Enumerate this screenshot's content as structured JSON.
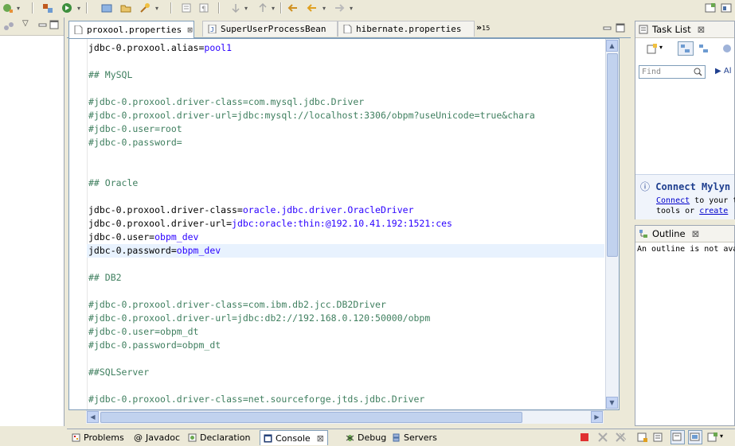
{
  "editor": {
    "tabs": [
      {
        "label": "proxool.properties",
        "active": true
      },
      {
        "label": "SuperUserProcessBean",
        "active": false
      },
      {
        "label": "hibernate.properties",
        "active": false
      }
    ],
    "overflow_count": "15",
    "lines": [
      {
        "type": "kv",
        "key": "jdbc-0.proxool.alias=",
        "value": "pool1"
      },
      {
        "type": "blank"
      },
      {
        "type": "comment",
        "text": "## MySQL"
      },
      {
        "type": "blank"
      },
      {
        "type": "comment",
        "text": "#jdbc-0.proxool.driver-class=com.mysql.jdbc.Driver"
      },
      {
        "type": "comment",
        "text": "#jdbc-0.proxool.driver-url=jdbc:mysql://localhost:3306/obpm?useUnicode=true&chara"
      },
      {
        "type": "comment",
        "text": "#jdbc-0.user=root"
      },
      {
        "type": "comment",
        "text": "#jdbc-0.password="
      },
      {
        "type": "blank"
      },
      {
        "type": "blank"
      },
      {
        "type": "comment",
        "text": "## Oracle"
      },
      {
        "type": "blank"
      },
      {
        "type": "kv",
        "key": "jdbc-0.proxool.driver-class=",
        "value": "oracle.jdbc.driver.OracleDriver"
      },
      {
        "type": "kv",
        "key": "jdbc-0.proxool.driver-url=",
        "value": "jdbc:oracle:thin:@192.10.41.192:1521:ces"
      },
      {
        "type": "kv",
        "key": "jdbc-0.user=",
        "value": "obpm_dev"
      },
      {
        "type": "kv",
        "key": "jdbc-0.password=",
        "value": "obpm_dev",
        "highlight": true
      },
      {
        "type": "blank"
      },
      {
        "type": "comment",
        "text": "## DB2"
      },
      {
        "type": "blank"
      },
      {
        "type": "comment",
        "text": "#jdbc-0.proxool.driver-class=com.ibm.db2.jcc.DB2Driver"
      },
      {
        "type": "comment",
        "text": "#jdbc-0.proxool.driver-url=jdbc:db2://192.168.0.120:50000/obpm"
      },
      {
        "type": "comment",
        "text": "#jdbc-0.user=obpm_dt"
      },
      {
        "type": "comment",
        "text": "#jdbc-0.password=obpm_dt"
      },
      {
        "type": "blank"
      },
      {
        "type": "comment",
        "text": "##SQLServer"
      },
      {
        "type": "blank"
      },
      {
        "type": "comment",
        "text": "#jdbc-0.proxool.driver-class=net.sourceforge.jtds.jdbc.Driver"
      }
    ]
  },
  "task_list": {
    "title": "Task List",
    "find_placeholder": "Find",
    "all_label": "Al",
    "connect_title": "Connect Mylyn",
    "connect_link": "Connect",
    "connect_text1": " to your t",
    "connect_text2": "tools or ",
    "create_link": "create"
  },
  "outline": {
    "title": "Outline",
    "message": "An outline is not ava"
  },
  "bottom_tabs": [
    {
      "label": "Problems",
      "icon": "problems-icon"
    },
    {
      "label": "Javadoc",
      "icon": "at-icon"
    },
    {
      "label": "Declaration",
      "icon": "declaration-icon"
    },
    {
      "label": "Console",
      "icon": "console-icon",
      "active": true
    },
    {
      "label": "Debug",
      "icon": "bug-icon"
    },
    {
      "label": "Servers",
      "icon": "servers-icon"
    }
  ],
  "colors": {
    "comment": "#3f7f5f",
    "value": "#2a00ff",
    "mylyn_title": "#1f3f8f",
    "link": "#0000cc"
  }
}
